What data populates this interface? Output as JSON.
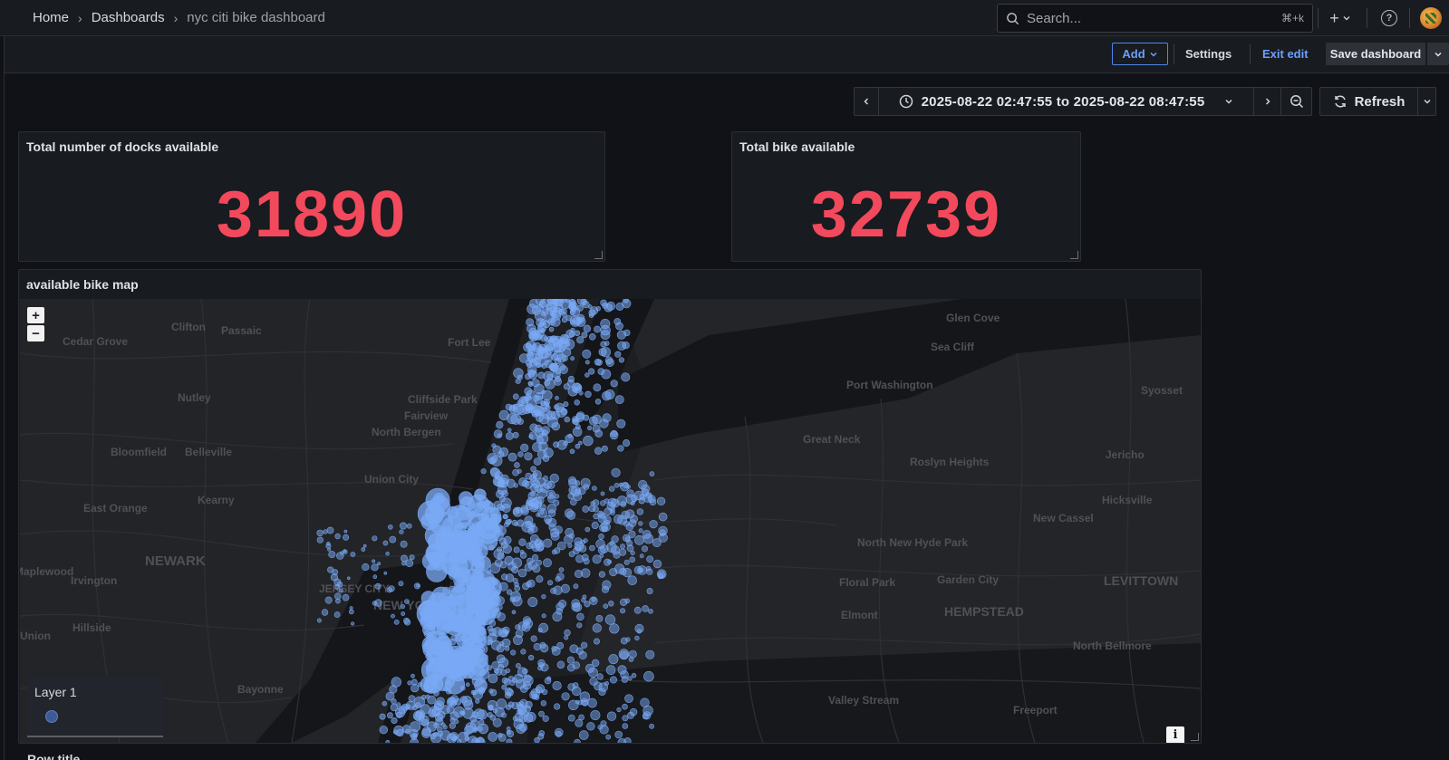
{
  "breadcrumb": {
    "home": "Home",
    "dashboards": "Dashboards",
    "current": "nyc citi bike dashboard"
  },
  "search": {
    "placeholder": "Search...",
    "shortcut": "⌘+k"
  },
  "toolbar": {
    "add_label": "Add",
    "settings_label": "Settings",
    "exit_label": "Exit edit",
    "save_label": "Save dashboard"
  },
  "time": {
    "range": "2025-08-22 02:47:55 to 2025-08-22 08:47:55",
    "refresh_label": "Refresh"
  },
  "panels": {
    "docks": {
      "title": "Total number of docks available",
      "value": "31890",
      "color": "#f2495c"
    },
    "bikes": {
      "title": "Total bike available",
      "value": "32739",
      "color": "#f2495c"
    },
    "map": {
      "title": "available bike map",
      "zoom_in": "+",
      "zoom_out": "−",
      "legend_title": "Layer 1",
      "info": "i",
      "marker_color": "#7aaaf5",
      "labels": [
        "Clifton",
        "Passaic",
        "Cedar Grove",
        "Nutley",
        "Bloomfield",
        "Belleville",
        "East Orange",
        "Kearny",
        "NEWARK",
        "Irvington",
        "Hillside",
        "Union",
        "Bayonne",
        "Union City",
        "North Bergen",
        "Fairview",
        "Cliffside Park",
        "Fort Lee",
        "Glen Cove",
        "Sea Cliff",
        "Port Washington",
        "Syosset",
        "Great Neck",
        "Roslyn Heights",
        "Jericho",
        "Hicksville",
        "New Cassel",
        "North New Hyde Park",
        "Floral Park",
        "Garden City",
        "LEVITTOWN",
        "Elmont",
        "HEMPSTEAD",
        "North Bellmore",
        "Valley Stream",
        "Freeport",
        "JERSEY CITY",
        "NEW YORK",
        "Maplewood"
      ]
    }
  },
  "next_row_title": "Row title"
}
